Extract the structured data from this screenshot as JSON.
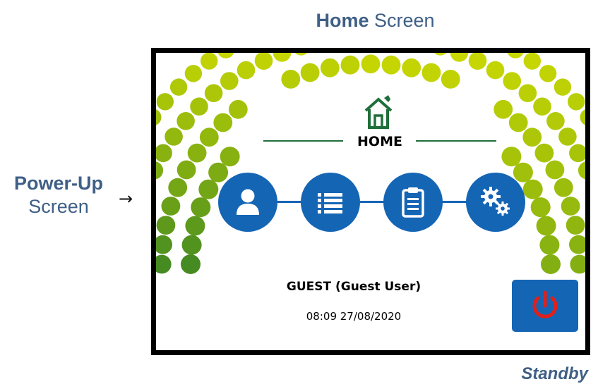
{
  "captions": {
    "title_bold": "Home",
    "title_rest": " Screen",
    "side_bold": "Power-Up",
    "side_rest": "Screen",
    "arrow": "→",
    "standby": "Standby"
  },
  "screen": {
    "home_title": "HOME",
    "user": "GUEST (Guest User)",
    "datetime": "08:09 27/08/2020"
  },
  "icons": {
    "home": "home-icon",
    "profile": "user-icon",
    "menu": "list-icon",
    "clipboard": "clipboard-icon",
    "settings": "gears-icon",
    "power": "power-icon"
  },
  "colors": {
    "button_blue": "#1565b5",
    "power_red": "#e0201b",
    "caption_blue": "#3f5f86",
    "home_green": "#1f6f3a"
  }
}
